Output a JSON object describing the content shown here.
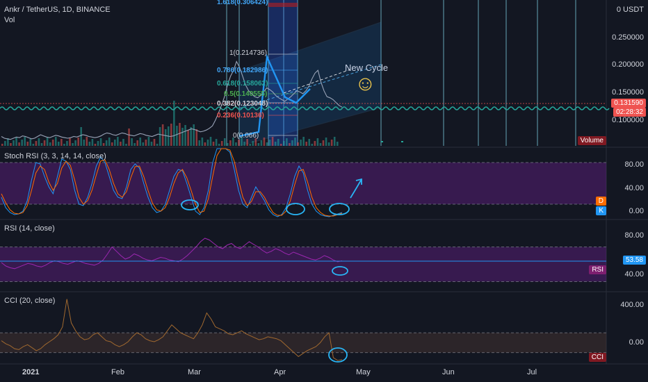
{
  "header": {
    "title": "Ankr / TetherUS, 1D, BINANCE",
    "volume_label": "Vol"
  },
  "price_axis": {
    "currency": "0 USDT",
    "ticks": [
      "0.250000",
      "0.200000",
      "0.150000",
      "0.100000"
    ],
    "current_price": "0.131590",
    "countdown": "02:28:32",
    "volume_badge": "Volume",
    "colors": {
      "current": "#ef5350",
      "volume_badge": "#801922"
    }
  },
  "fib_levels": [
    {
      "label": "1.618(0.306424)",
      "color": "#42a5f5"
    },
    {
      "label": "1(0.214736)",
      "color": "#d1d4dc"
    },
    {
      "label": "0.786(0.182986)",
      "color": "#42a5f5"
    },
    {
      "label": "0.618(0.158062)",
      "color": "#26a69a"
    },
    {
      "label": "0.5(0.140555)",
      "color": "#4caf50"
    },
    {
      "label": "0.382(0.123048)",
      "color": "#d1d4dc"
    },
    {
      "label": "0.236(0.10136)",
      "color": "#ef5350"
    },
    {
      "label": "0(0.066)",
      "color": "#d1d4dc"
    }
  ],
  "annotation": {
    "text": "New Cycle",
    "smiley": "☺"
  },
  "stoch": {
    "title": "Stoch RSI (3, 3, 14, 14, close)",
    "ticks": [
      "80.00",
      "40.00",
      "0.00"
    ],
    "badge_d": "D",
    "badge_k": "K"
  },
  "rsi": {
    "title": "RSI (14, close)",
    "ticks": [
      "80.00",
      "40.00"
    ],
    "value": "53.58",
    "badge": "RSI"
  },
  "cci": {
    "title": "CCI (20, close)",
    "ticks": [
      "400.00",
      "0.00"
    ],
    "badge": "CCI"
  },
  "time_axis": {
    "labels": [
      "2021",
      "Feb",
      "Mar",
      "Apr",
      "May",
      "Jun",
      "Jul"
    ]
  },
  "chart_data": [
    {
      "type": "line",
      "title": "Ankr / TetherUS, 1D, BINANCE",
      "ylim": [
        0.066,
        0.31
      ],
      "series": [
        {
          "values": [
            0.082,
            0.079,
            0.078,
            0.077,
            0.079,
            0.081,
            0.08,
            0.083,
            0.082,
            0.08,
            0.078,
            0.079,
            0.082,
            0.085,
            0.083,
            0.081,
            0.08,
            0.082,
            0.084,
            0.083,
            0.081,
            0.08,
            0.079,
            0.08,
            0.082,
            0.081,
            0.083,
            0.085,
            0.084,
            0.082,
            0.081,
            0.08,
            0.081,
            0.083,
            0.086,
            0.088,
            0.087,
            0.085,
            0.084,
            0.086,
            0.088,
            0.087,
            0.085,
            0.084,
            0.083,
            0.085,
            0.087,
            0.086,
            0.084,
            0.083,
            0.082,
            0.084,
            0.086,
            0.085,
            0.084,
            0.083,
            0.082,
            0.083,
            0.085,
            0.087,
            0.089,
            0.091,
            0.093,
            0.095,
            0.094,
            0.092,
            0.09,
            0.091,
            0.093,
            0.096,
            0.1,
            0.11,
            0.122,
            0.135,
            0.15,
            0.17,
            0.185,
            0.195,
            0.21,
            0.2,
            0.185,
            0.17,
            0.16,
            0.155,
            0.15,
            0.148,
            0.152,
            0.158,
            0.165,
            0.162,
            0.158,
            0.152,
            0.148,
            0.145,
            0.142,
            0.146,
            0.15,
            0.155,
            0.16,
            0.158,
            0.155,
            0.16,
            0.168,
            0.18,
            0.19,
            0.195,
            0.175,
            0.16,
            0.15,
            0.148,
            0.145,
            0.14,
            0.135,
            0.132
          ]
        }
      ]
    },
    {
      "type": "line",
      "title": "Stoch RSI (3, 3, 14, 14, close)",
      "ylim": [
        0,
        100
      ],
      "series": [
        {
          "name": "K",
          "values": [
            30,
            15,
            8,
            5,
            6,
            10,
            25,
            55,
            80,
            78,
            60,
            45,
            35,
            60,
            85,
            82,
            70,
            40,
            20,
            18,
            30,
            50,
            75,
            88,
            80,
            60,
            40,
            30,
            28,
            45,
            70,
            78,
            72,
            50,
            30,
            15,
            8,
            10,
            20,
            40,
            60,
            70,
            68,
            50,
            30,
            10,
            5,
            15,
            40,
            80,
            100,
            100,
            100,
            95,
            70,
            40,
            20,
            15,
            30,
            45,
            35,
            25,
            12,
            5,
            2,
            5,
            15,
            35,
            60,
            75,
            65,
            40,
            20,
            10,
            5,
            3,
            2,
            4,
            6,
            8
          ]
        },
        {
          "name": "D",
          "values": [
            35,
            22,
            12,
            7,
            6,
            8,
            18,
            40,
            65,
            75,
            70,
            52,
            40,
            50,
            72,
            82,
            76,
            55,
            30,
            20,
            25,
            40,
            62,
            82,
            84,
            70,
            50,
            35,
            30,
            38,
            58,
            74,
            75,
            60,
            40,
            22,
            12,
            10,
            15,
            30,
            50,
            65,
            70,
            58,
            40,
            20,
            8,
            10,
            28,
            60,
            90,
            100,
            100,
            98,
            82,
            55,
            30,
            18,
            24,
            38,
            38,
            30,
            18,
            8,
            4,
            4,
            10,
            25,
            48,
            68,
            70,
            52,
            30,
            15,
            8,
            4,
            3,
            3,
            5,
            7
          ]
        }
      ]
    },
    {
      "type": "line",
      "title": "RSI (14, close)",
      "ylim": [
        20,
        100
      ],
      "series": [
        {
          "values": [
            52,
            48,
            46,
            45,
            47,
            49,
            51,
            50,
            48,
            47,
            49,
            52,
            54,
            53,
            51,
            50,
            52,
            54,
            53,
            51,
            50,
            49,
            51,
            55,
            62,
            70,
            65,
            60,
            56,
            58,
            62,
            60,
            57,
            55,
            54,
            56,
            58,
            57,
            55,
            54,
            53,
            56,
            60,
            65,
            70,
            76,
            80,
            78,
            74,
            70,
            68,
            72,
            74,
            70,
            68,
            72,
            76,
            73,
            70,
            66,
            63,
            65,
            68,
            66,
            63,
            61,
            64,
            62,
            60,
            58,
            56,
            55,
            57,
            60,
            58,
            55,
            53,
            54
          ]
        }
      ]
    },
    {
      "type": "line",
      "title": "CCI (20, close)",
      "ylim": [
        -200,
        500
      ],
      "series": [
        {
          "values": [
            20,
            -10,
            -30,
            -60,
            -70,
            -40,
            -20,
            -50,
            -80,
            -60,
            -20,
            10,
            40,
            80,
            160,
            440,
            200,
            120,
            60,
            30,
            40,
            80,
            100,
            60,
            20,
            10,
            -20,
            -40,
            -20,
            10,
            60,
            100,
            80,
            40,
            20,
            10,
            30,
            60,
            120,
            180,
            140,
            100,
            80,
            60,
            40,
            100,
            180,
            300,
            240,
            160,
            140,
            120,
            90,
            80,
            100,
            120,
            90,
            70,
            50,
            30,
            40,
            60,
            50,
            40,
            20,
            -20,
            -60,
            -100,
            -140,
            -110,
            -80,
            -60,
            -40,
            0,
            60,
            100,
            -150,
            -180,
            -170
          ]
        }
      ]
    }
  ]
}
